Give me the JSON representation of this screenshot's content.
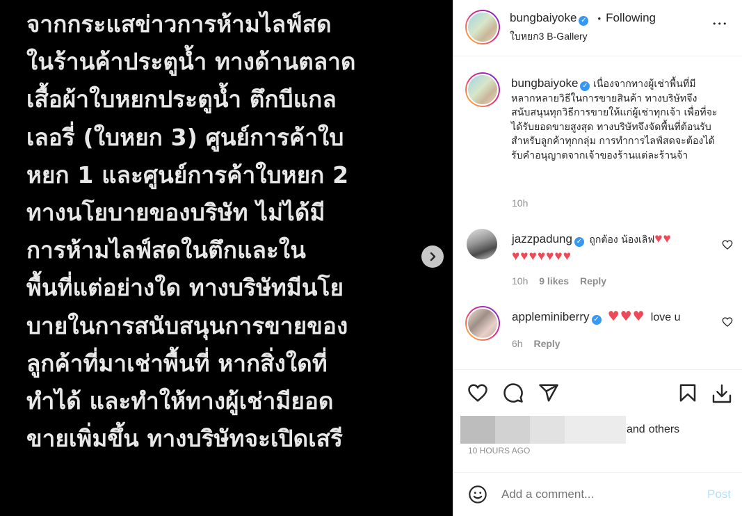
{
  "post": {
    "lines": [
      "จากกระแสข่าวการห้ามไลฟ์สด",
      "ในร้านค้าประตูน้ำ ทางด้านตลาด",
      "เสื้อผ้าใบหยกประตูน้ำ ตึกบีแกล",
      "เลอรี่ (ใบหยก 3) ศูนย์การค้าใบ",
      "หยก 1 และศูนย์การค้าใบหยก 2",
      "ทางนโยบายของบริษัท ไม่ได้มี",
      "การห้ามไลฟ์สดในตึกและใน",
      "พื้นที่แต่อย่างใด ทางบริษัทมีนโย",
      "บายในการสนับสนุนการขายของ",
      "ลูกค้าที่มาเช่าพื้นที่ หากสิ่งใดที่",
      "ทำได้ และทำให้ทางผู้เช่ามียอด",
      "ขายเพิ่มขึ้น ทางบริษัทจะเปิดเสรี"
    ]
  },
  "header": {
    "username": "bungbaiyoke",
    "separator": "•",
    "follow_status": "Following",
    "location": "ใบหยก3 B-Gallery",
    "more": "•••"
  },
  "caption": {
    "username": "bungbaiyoke",
    "text": "เนื่องจากทางผู้เช่าพื้นที่มีหลากหลายวิธีในการขายสินค้า ทางบริษัทจึงสนับสนุนทุกวิธีการขายให้แก่ผู้เช่าทุกเจ้า เพื่อที่จะได้รับยอดขายสูงสุด ทางบริษัทจึงจัดพื้นที่ต้อนรับสำหรับลูกค้าทุกกลุ่ม การทำการไลฟ์สดจะต้องได้รับคำอนุญาตจากเจ้าของร้านแต่ละร้านจ้า",
    "time": "10h"
  },
  "comments": [
    {
      "username": "jazzpadung",
      "text": "ถูกต้อง น้องเลิฟ",
      "hearts_inline": 2,
      "hearts_line2": 7,
      "time": "10h",
      "likes": "9 likes",
      "reply": "Reply"
    },
    {
      "username": "appleminiberry",
      "hearts_inline": 3,
      "text": "love u",
      "time": "6h",
      "reply": "Reply"
    }
  ],
  "likes": {
    "others_prefix": "and",
    "others_label": "others",
    "date": "10 HOURS AGO"
  },
  "comment_box": {
    "placeholder": "Add a comment...",
    "post_label": "Post"
  },
  "colors": {
    "accent": "#3897f0",
    "heart": "#ed4956",
    "post_disabled": "#b2dffc"
  }
}
